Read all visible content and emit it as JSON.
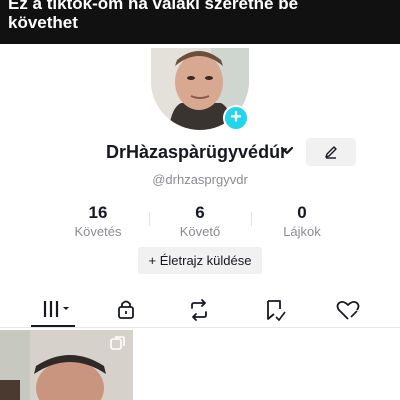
{
  "caption": {
    "line1": "Ez a tiktok-om  ha valaki szeretné be",
    "line2": "követhet"
  },
  "profile": {
    "username": "DrHàzaspàrügyvédúr",
    "handle": "@drhzasprgyvdr",
    "avatar_badge_icon": "plus-icon"
  },
  "stats": {
    "following": {
      "value": "16",
      "label": "Követés"
    },
    "followers": {
      "value": "6",
      "label": "Követő"
    },
    "likes": {
      "value": "0",
      "label": "Lájkok"
    }
  },
  "bio_button": {
    "icon": "+",
    "label": "Életrajz küldése"
  },
  "tabs": [
    {
      "name": "videos-grid-icon",
      "active": true
    },
    {
      "name": "lock-icon",
      "active": false
    },
    {
      "name": "repost-icon",
      "active": false
    },
    {
      "name": "bookmark-icon",
      "active": false
    },
    {
      "name": "liked-icon",
      "active": false
    }
  ],
  "colors": {
    "banner_bg": "#111111",
    "badge": "#20d5ec",
    "text_primary": "#161823",
    "text_secondary": "#8a8b91"
  }
}
